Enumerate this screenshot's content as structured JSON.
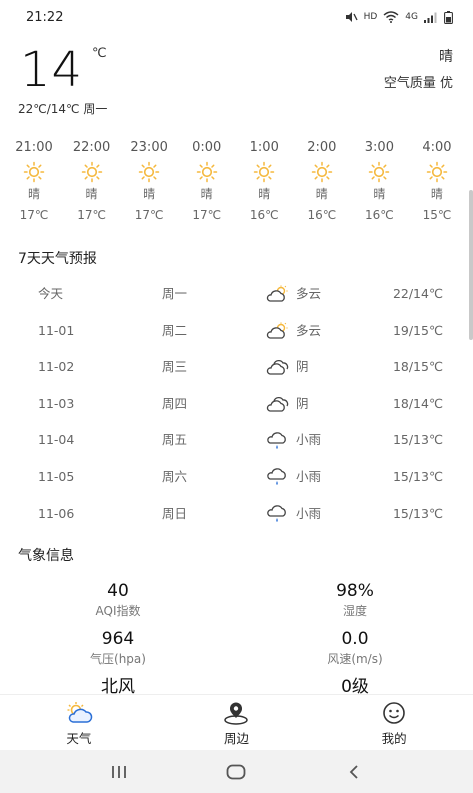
{
  "status_bar": {
    "time": "21:22",
    "network": "4G",
    "hd": "HD"
  },
  "current": {
    "temp": "14",
    "unit": "℃",
    "condition": "晴",
    "air_quality": "空气质量 优",
    "range_day": "22℃/14℃ 周一"
  },
  "hourly": [
    {
      "time": "21:00",
      "icon": "sun-icon",
      "cond": "晴",
      "temp": "17℃"
    },
    {
      "time": "22:00",
      "icon": "sun-icon",
      "cond": "晴",
      "temp": "17℃"
    },
    {
      "time": "23:00",
      "icon": "sun-icon",
      "cond": "晴",
      "temp": "17℃"
    },
    {
      "time": "0:00",
      "icon": "sun-icon",
      "cond": "晴",
      "temp": "17℃"
    },
    {
      "time": "1:00",
      "icon": "sun-icon",
      "cond": "晴",
      "temp": "16℃"
    },
    {
      "time": "2:00",
      "icon": "sun-icon",
      "cond": "晴",
      "temp": "16℃"
    },
    {
      "time": "3:00",
      "icon": "sun-icon",
      "cond": "晴",
      "temp": "16℃"
    },
    {
      "time": "4:00",
      "icon": "sun-icon",
      "cond": "晴",
      "temp": "15℃"
    }
  ],
  "forecast_title": "7天天气预报",
  "forecast": [
    {
      "date": "今天",
      "day": "周一",
      "icon": "partly-cloudy-icon",
      "cond": "多云",
      "temp": "22/14℃"
    },
    {
      "date": "11-01",
      "day": "周二",
      "icon": "partly-cloudy-icon",
      "cond": "多云",
      "temp": "19/15℃"
    },
    {
      "date": "11-02",
      "day": "周三",
      "icon": "cloud-icon",
      "cond": "阴",
      "temp": "18/15℃"
    },
    {
      "date": "11-03",
      "day": "周四",
      "icon": "cloud-icon",
      "cond": "阴",
      "temp": "18/14℃"
    },
    {
      "date": "11-04",
      "day": "周五",
      "icon": "light-rain-icon",
      "cond": "小雨",
      "temp": "15/13℃"
    },
    {
      "date": "11-05",
      "day": "周六",
      "icon": "light-rain-icon",
      "cond": "小雨",
      "temp": "15/13℃"
    },
    {
      "date": "11-06",
      "day": "周日",
      "icon": "light-rain-icon",
      "cond": "小雨",
      "temp": "15/13℃"
    }
  ],
  "info_title": "气象信息",
  "info": [
    {
      "value": "40",
      "label": "AQI指数"
    },
    {
      "value": "98%",
      "label": "湿度"
    },
    {
      "value": "964",
      "label": "气压(hpa)"
    },
    {
      "value": "0.0",
      "label": "风速(m/s)"
    },
    {
      "value": "北风",
      "label": ""
    },
    {
      "value": "0级",
      "label": ""
    }
  ],
  "tabs": [
    {
      "label": "天气",
      "icon": "weather-icon"
    },
    {
      "label": "周边",
      "icon": "location-pin-icon"
    },
    {
      "label": "我的",
      "icon": "smile-icon"
    }
  ],
  "colors": {
    "sun": "#f5b83d",
    "rain_drop": "#2b6fd6",
    "nav_bg": "#f2f2f2"
  }
}
